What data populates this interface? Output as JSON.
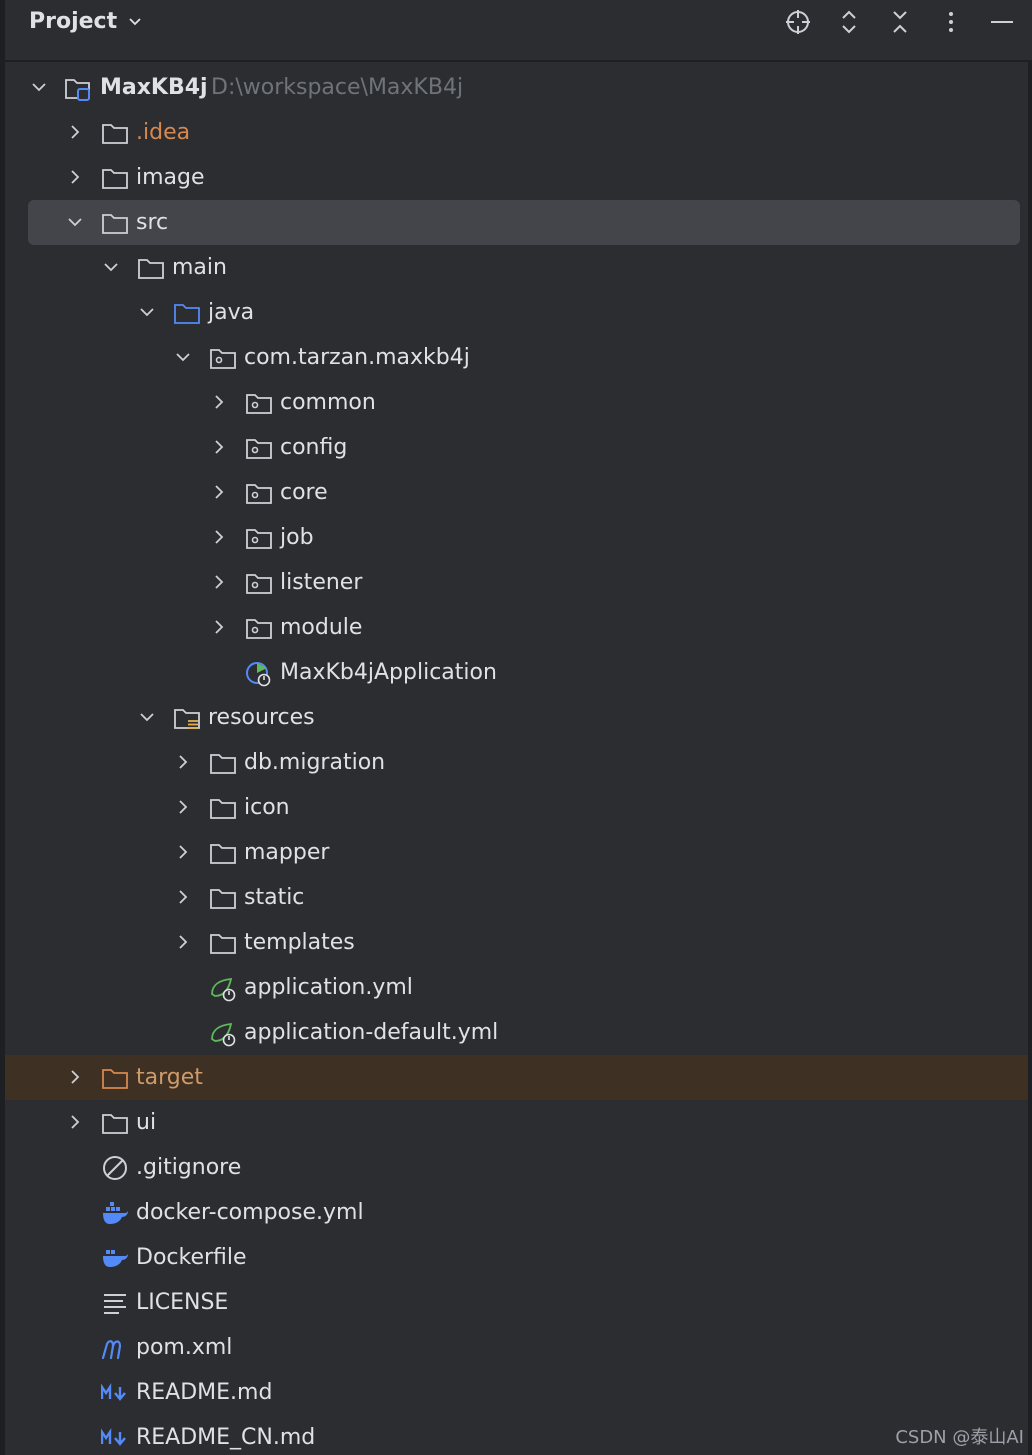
{
  "header": {
    "title": "Project",
    "buttons": [
      "locate-icon",
      "expand-all-icon",
      "collapse-all-icon",
      "more-options-icon",
      "hide-icon"
    ]
  },
  "tree": {
    "root": {
      "label": "MaxKB4j",
      "path": "D:\\workspace\\MaxKB4j"
    },
    "idea": ".idea",
    "image": "image",
    "src": "src",
    "main": "main",
    "java": "java",
    "package": "com.tarzan.maxkb4j",
    "packages": [
      "common",
      "config",
      "core",
      "job",
      "listener",
      "module"
    ],
    "app_class": "MaxKb4jApplication",
    "resources": "resources",
    "resource_dirs": [
      "db.migration",
      "icon",
      "mapper",
      "static",
      "templates"
    ],
    "resource_files": [
      "application.yml",
      "application-default.yml"
    ],
    "target": "target",
    "ui": "ui",
    "gitignore": ".gitignore",
    "docker_compose": "docker-compose.yml",
    "dockerfile": "Dockerfile",
    "license": "LICENSE",
    "pom": "pom.xml",
    "readme": "README.md",
    "readme_cn": "README_CN.md"
  },
  "colors": {
    "background": "#2b2d30",
    "selection": "#43454a",
    "excluded": "#3e3124",
    "text": "#dfe1e5",
    "muted": "#6f737a",
    "orange": "#d5884f",
    "java_blue": "#548af7",
    "spring_green": "#5fb85a"
  },
  "watermark": "CSDN @泰山AI"
}
